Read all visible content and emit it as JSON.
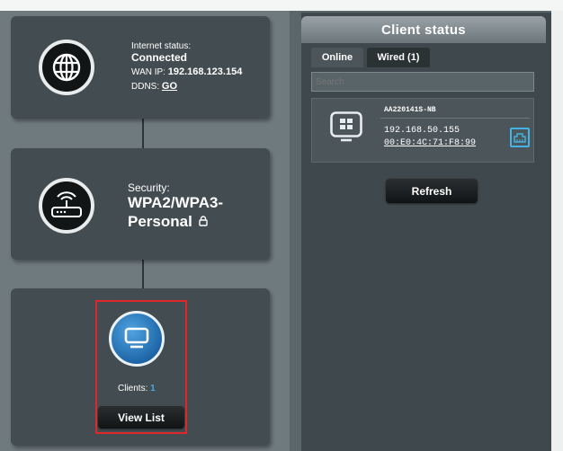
{
  "internet": {
    "status_label": "Internet status:",
    "status_value": "Connected",
    "wan_label": "WAN IP:",
    "wan_value": "192.168.123.154",
    "ddns_label": "DDNS:",
    "ddns_link": "GO"
  },
  "security": {
    "label": "Security:",
    "value_line1": "WPA2/WPA3-",
    "value_line2": "Personal"
  },
  "clients": {
    "label": "Clients:",
    "count": "1",
    "view_list_button": "View List"
  },
  "client_status": {
    "title": "Client status",
    "tabs": [
      {
        "label": "Online",
        "active": true
      },
      {
        "label": "Wired (1)",
        "active": false
      }
    ],
    "search_placeholder": "Search",
    "entries": [
      {
        "name": "AA220141S-NB",
        "ip": "192.168.50.155",
        "mac": "00:E0:4C:71:F8:99"
      }
    ],
    "refresh_button": "Refresh"
  },
  "colors": {
    "accent_blue": "#1e66a8",
    "highlight_red": "#e0262b",
    "link_blue": "#4aa6e8"
  },
  "icons": [
    "globe-icon",
    "router-icon",
    "lock-icon",
    "monitor-icon",
    "windows-pc-icon",
    "ethernet-icon"
  ]
}
